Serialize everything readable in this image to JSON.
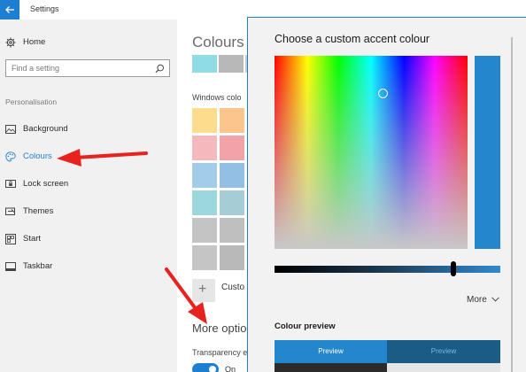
{
  "window": {
    "title": "Settings"
  },
  "sidebar": {
    "home_label": "Home",
    "search_placeholder": "Find a setting",
    "section_label": "Personalisation",
    "items": [
      {
        "label": "Background",
        "icon": "image-icon"
      },
      {
        "label": "Colours",
        "icon": "palette-icon",
        "selected": true
      },
      {
        "label": "Lock screen",
        "icon": "lock-screen-icon"
      },
      {
        "label": "Themes",
        "icon": "themes-icon"
      },
      {
        "label": "Start",
        "icon": "start-icon"
      },
      {
        "label": "Taskbar",
        "icon": "taskbar-icon"
      }
    ]
  },
  "main": {
    "title": "Colours",
    "recent_colours": [
      "#8fdce6",
      "#b8b8b8",
      "#c9c9c9"
    ],
    "windows_colours_label": "Windows colo",
    "colour_grid": [
      [
        "#fddc8d",
        "#fcc58e",
        "#ffd39a"
      ],
      [
        "#f5b8bd",
        "#f2a2a8",
        "#f7b7c0"
      ],
      [
        "#a3cbea",
        "#93bfe5",
        "#a9c6e6"
      ],
      [
        "#9dd7de",
        "#a6ccd6",
        "#b3d4dc"
      ],
      [
        "#c4c4c4",
        "#bfbfbf",
        "#c7c7c7"
      ],
      [
        "#c5c5c5",
        "#b9b9b9",
        "#c1c1c1"
      ]
    ],
    "custom_label": "Custo",
    "more_options_label": "More optio",
    "transparency_label": "Transparency e",
    "toggle_label": "On"
  },
  "dialog": {
    "title": "Choose a custom accent colour",
    "accent_color": "#2486cc",
    "more_label": "More",
    "preview_label": "Colour preview",
    "preview_left": "Preview",
    "preview_right": "Preview"
  },
  "colors": {
    "accent": "#1e7fd0",
    "annotation_arrow": "#e8231f"
  }
}
